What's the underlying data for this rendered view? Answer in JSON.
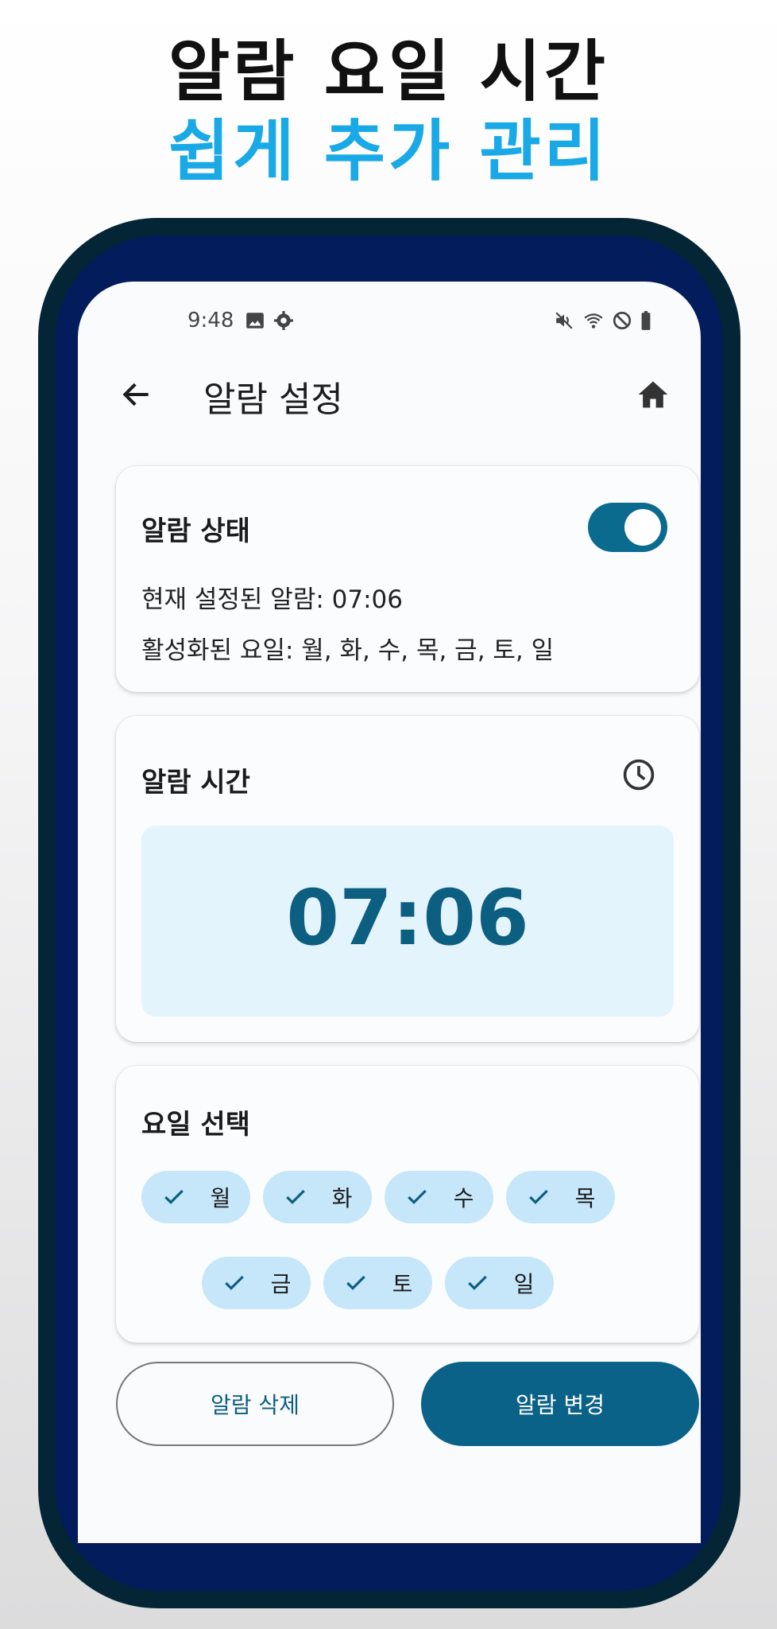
{
  "headline": {
    "line1": "알람 요일 시간",
    "line2": "쉽게 추가 관리"
  },
  "statusbar": {
    "time": "9:48",
    "left_icons": [
      "image-icon",
      "gear-icon"
    ],
    "right_icons": [
      "mute-icon",
      "wifi-icon",
      "blocked-icon",
      "battery-icon"
    ]
  },
  "appbar": {
    "title": "알람 설정"
  },
  "status_card": {
    "title": "알람 상태",
    "toggle_on": true,
    "current_alarm": "현재 설정된 알람: 07:06",
    "active_days": "활성화된 요일: 월, 화, 수, 목, 금, 토, 일"
  },
  "time_card": {
    "title": "알람 시간",
    "time": "07:06"
  },
  "days_card": {
    "title": "요일 선택",
    "days": [
      "월",
      "화",
      "수",
      "목",
      "금",
      "토",
      "일"
    ]
  },
  "buttons": {
    "delete": "알람 삭제",
    "change": "알람 변경"
  },
  "colors": {
    "accent": "#0b6b8e",
    "chip": "#c6e6f9",
    "headline_blue": "#19a9e6"
  }
}
